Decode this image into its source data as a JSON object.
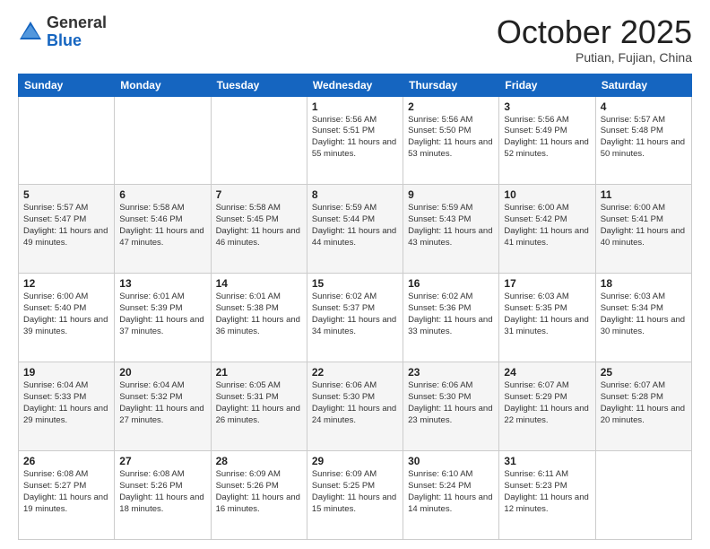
{
  "header": {
    "logo_general": "General",
    "logo_blue": "Blue",
    "month": "October 2025",
    "location": "Putian, Fujian, China"
  },
  "weekdays": [
    "Sunday",
    "Monday",
    "Tuesday",
    "Wednesday",
    "Thursday",
    "Friday",
    "Saturday"
  ],
  "weeks": [
    [
      {
        "day": "",
        "info": ""
      },
      {
        "day": "",
        "info": ""
      },
      {
        "day": "",
        "info": ""
      },
      {
        "day": "1",
        "info": "Sunrise: 5:56 AM\nSunset: 5:51 PM\nDaylight: 11 hours and 55 minutes."
      },
      {
        "day": "2",
        "info": "Sunrise: 5:56 AM\nSunset: 5:50 PM\nDaylight: 11 hours and 53 minutes."
      },
      {
        "day": "3",
        "info": "Sunrise: 5:56 AM\nSunset: 5:49 PM\nDaylight: 11 hours and 52 minutes."
      },
      {
        "day": "4",
        "info": "Sunrise: 5:57 AM\nSunset: 5:48 PM\nDaylight: 11 hours and 50 minutes."
      }
    ],
    [
      {
        "day": "5",
        "info": "Sunrise: 5:57 AM\nSunset: 5:47 PM\nDaylight: 11 hours and 49 minutes."
      },
      {
        "day": "6",
        "info": "Sunrise: 5:58 AM\nSunset: 5:46 PM\nDaylight: 11 hours and 47 minutes."
      },
      {
        "day": "7",
        "info": "Sunrise: 5:58 AM\nSunset: 5:45 PM\nDaylight: 11 hours and 46 minutes."
      },
      {
        "day": "8",
        "info": "Sunrise: 5:59 AM\nSunset: 5:44 PM\nDaylight: 11 hours and 44 minutes."
      },
      {
        "day": "9",
        "info": "Sunrise: 5:59 AM\nSunset: 5:43 PM\nDaylight: 11 hours and 43 minutes."
      },
      {
        "day": "10",
        "info": "Sunrise: 6:00 AM\nSunset: 5:42 PM\nDaylight: 11 hours and 41 minutes."
      },
      {
        "day": "11",
        "info": "Sunrise: 6:00 AM\nSunset: 5:41 PM\nDaylight: 11 hours and 40 minutes."
      }
    ],
    [
      {
        "day": "12",
        "info": "Sunrise: 6:00 AM\nSunset: 5:40 PM\nDaylight: 11 hours and 39 minutes."
      },
      {
        "day": "13",
        "info": "Sunrise: 6:01 AM\nSunset: 5:39 PM\nDaylight: 11 hours and 37 minutes."
      },
      {
        "day": "14",
        "info": "Sunrise: 6:01 AM\nSunset: 5:38 PM\nDaylight: 11 hours and 36 minutes."
      },
      {
        "day": "15",
        "info": "Sunrise: 6:02 AM\nSunset: 5:37 PM\nDaylight: 11 hours and 34 minutes."
      },
      {
        "day": "16",
        "info": "Sunrise: 6:02 AM\nSunset: 5:36 PM\nDaylight: 11 hours and 33 minutes."
      },
      {
        "day": "17",
        "info": "Sunrise: 6:03 AM\nSunset: 5:35 PM\nDaylight: 11 hours and 31 minutes."
      },
      {
        "day": "18",
        "info": "Sunrise: 6:03 AM\nSunset: 5:34 PM\nDaylight: 11 hours and 30 minutes."
      }
    ],
    [
      {
        "day": "19",
        "info": "Sunrise: 6:04 AM\nSunset: 5:33 PM\nDaylight: 11 hours and 29 minutes."
      },
      {
        "day": "20",
        "info": "Sunrise: 6:04 AM\nSunset: 5:32 PM\nDaylight: 11 hours and 27 minutes."
      },
      {
        "day": "21",
        "info": "Sunrise: 6:05 AM\nSunset: 5:31 PM\nDaylight: 11 hours and 26 minutes."
      },
      {
        "day": "22",
        "info": "Sunrise: 6:06 AM\nSunset: 5:30 PM\nDaylight: 11 hours and 24 minutes."
      },
      {
        "day": "23",
        "info": "Sunrise: 6:06 AM\nSunset: 5:30 PM\nDaylight: 11 hours and 23 minutes."
      },
      {
        "day": "24",
        "info": "Sunrise: 6:07 AM\nSunset: 5:29 PM\nDaylight: 11 hours and 22 minutes."
      },
      {
        "day": "25",
        "info": "Sunrise: 6:07 AM\nSunset: 5:28 PM\nDaylight: 11 hours and 20 minutes."
      }
    ],
    [
      {
        "day": "26",
        "info": "Sunrise: 6:08 AM\nSunset: 5:27 PM\nDaylight: 11 hours and 19 minutes."
      },
      {
        "day": "27",
        "info": "Sunrise: 6:08 AM\nSunset: 5:26 PM\nDaylight: 11 hours and 18 minutes."
      },
      {
        "day": "28",
        "info": "Sunrise: 6:09 AM\nSunset: 5:26 PM\nDaylight: 11 hours and 16 minutes."
      },
      {
        "day": "29",
        "info": "Sunrise: 6:09 AM\nSunset: 5:25 PM\nDaylight: 11 hours and 15 minutes."
      },
      {
        "day": "30",
        "info": "Sunrise: 6:10 AM\nSunset: 5:24 PM\nDaylight: 11 hours and 14 minutes."
      },
      {
        "day": "31",
        "info": "Sunrise: 6:11 AM\nSunset: 5:23 PM\nDaylight: 11 hours and 12 minutes."
      },
      {
        "day": "",
        "info": ""
      }
    ]
  ]
}
